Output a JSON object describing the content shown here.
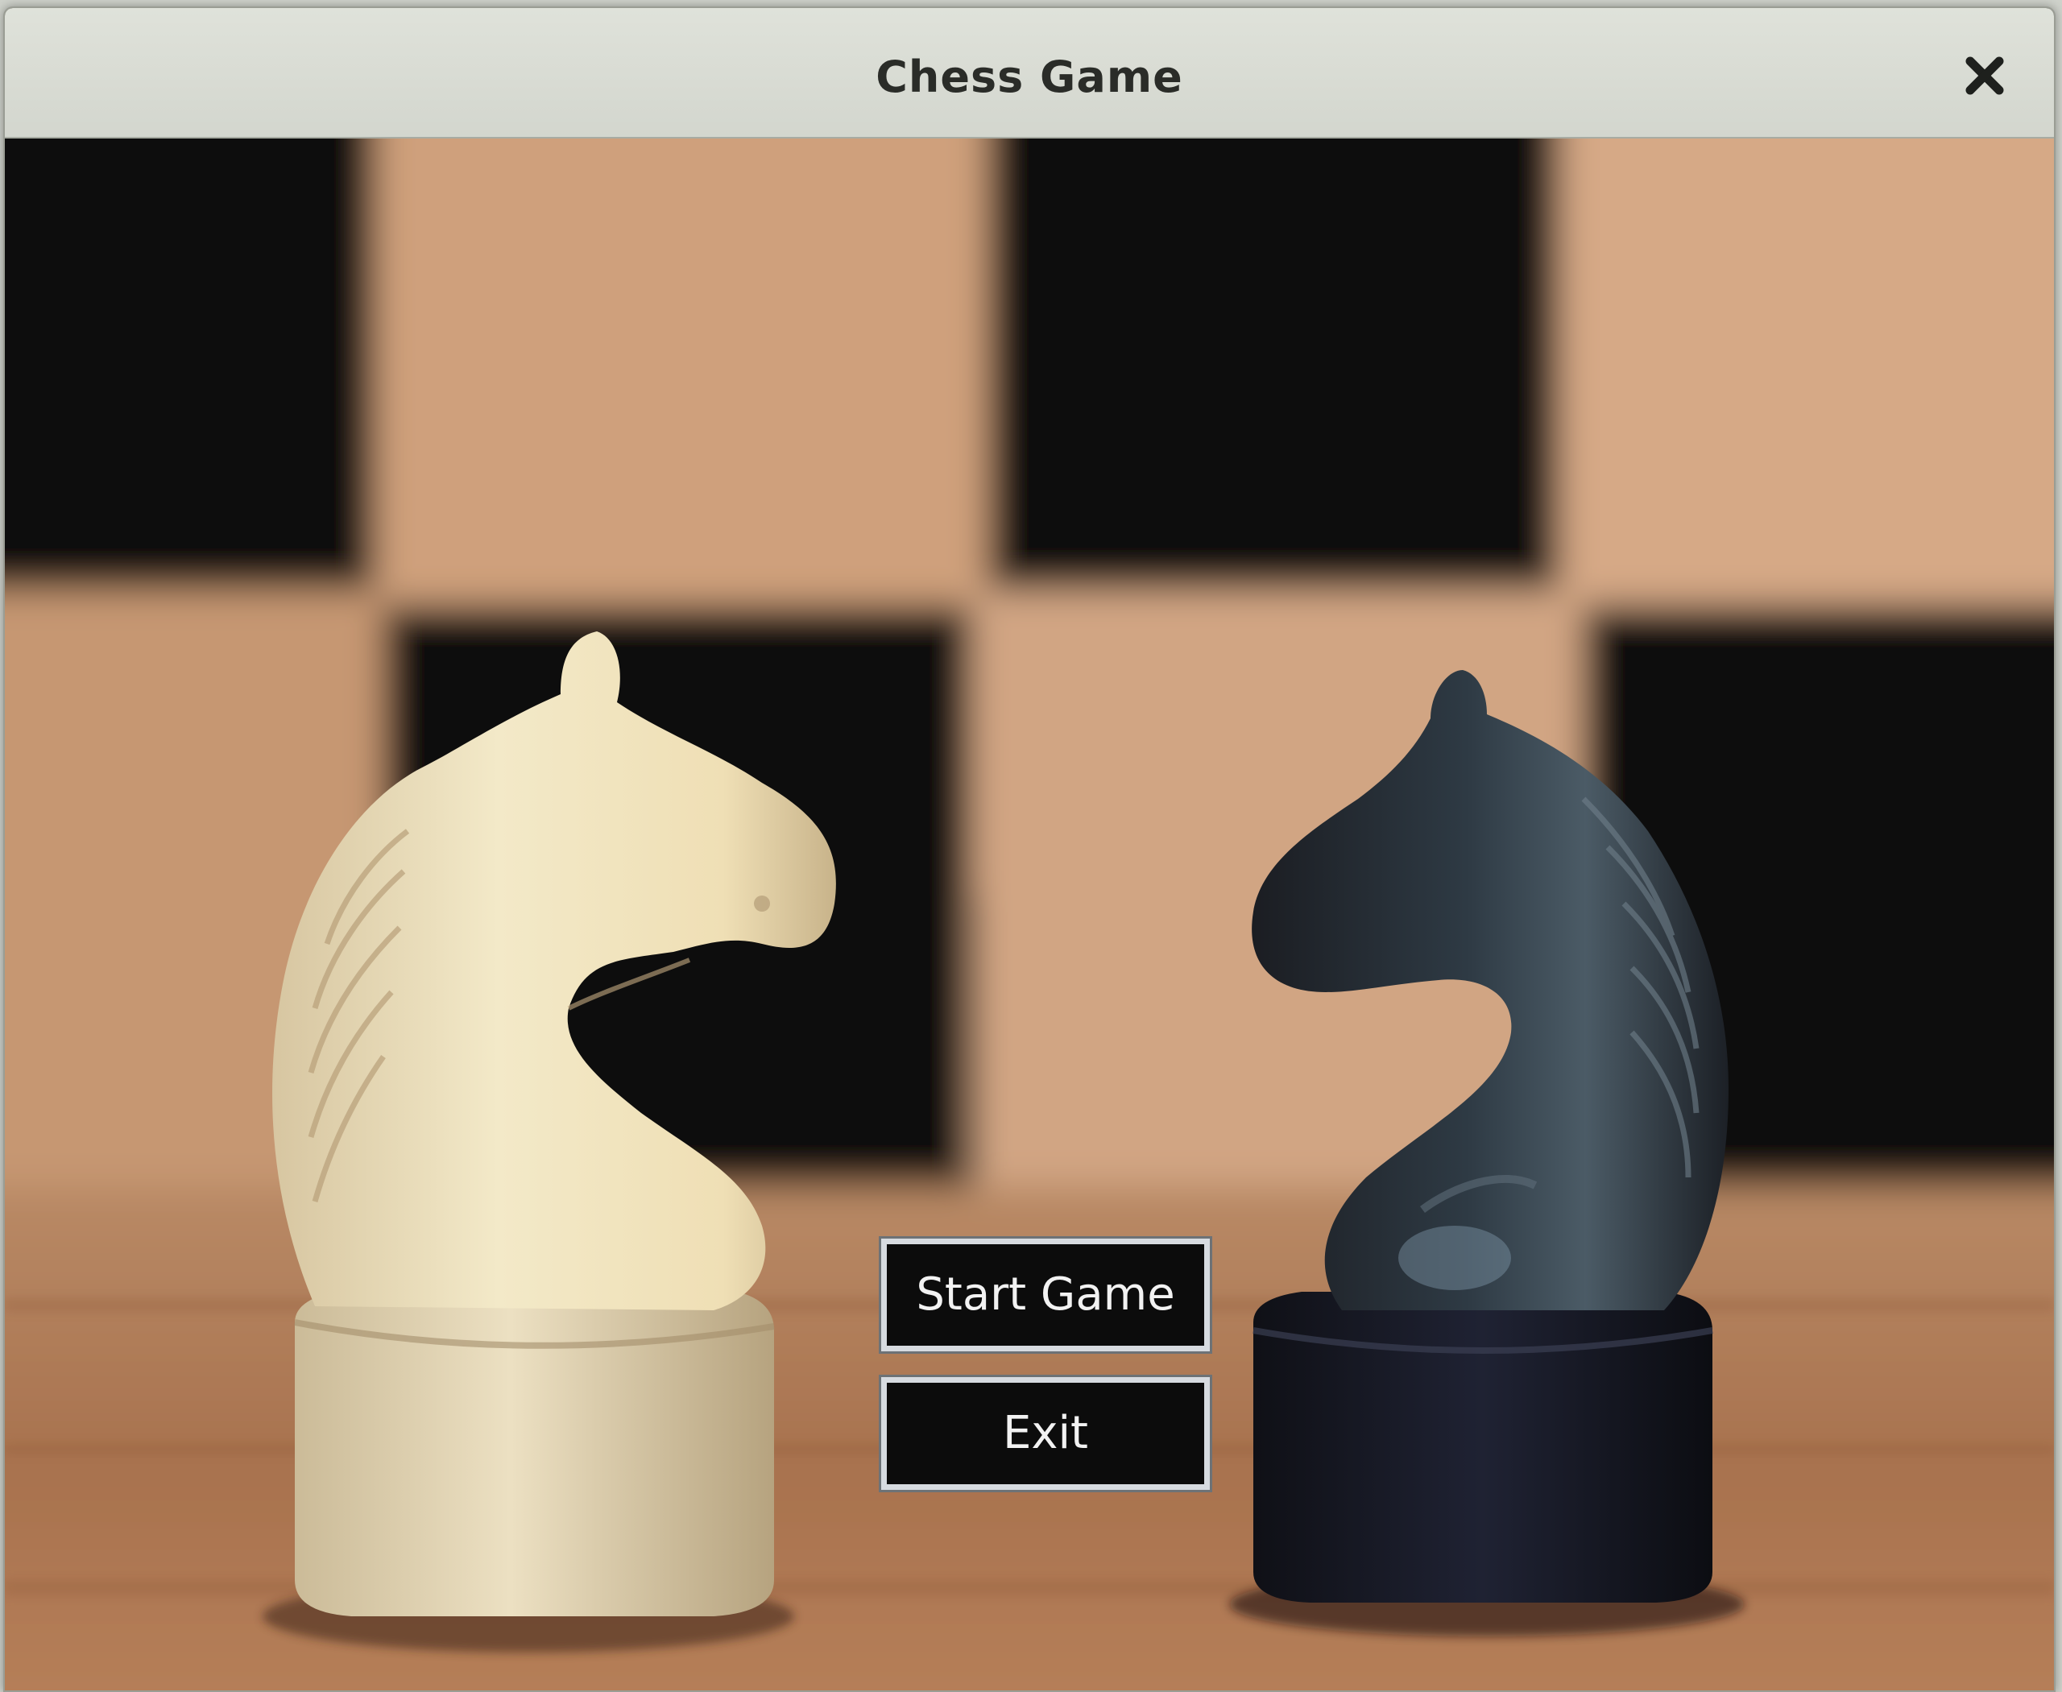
{
  "window": {
    "title": "Chess Game",
    "close_icon": "close-icon"
  },
  "menu": {
    "start_label": "Start Game",
    "exit_label": "Exit"
  },
  "background": {
    "icon": "chess-knights-photo",
    "board_dark": "#0d0c0b",
    "board_light": "#d2a47e",
    "table": "#b07a55"
  }
}
